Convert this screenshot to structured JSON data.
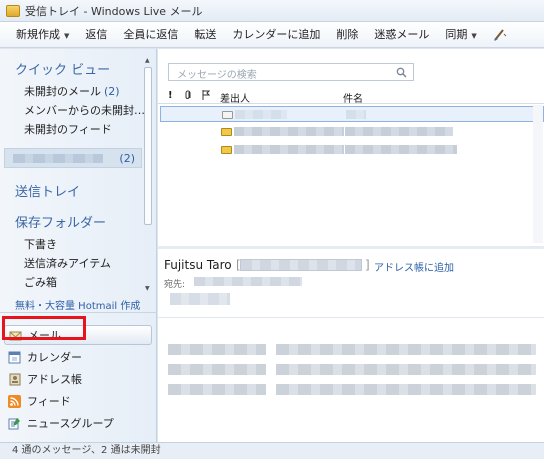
{
  "window": {
    "title": "受信トレイ - Windows Live メール"
  },
  "toolbar": {
    "items": [
      {
        "label": "新規作成",
        "dropdown": true
      },
      {
        "label": "返信"
      },
      {
        "label": "全員に返信"
      },
      {
        "label": "転送"
      },
      {
        "label": "カレンダーに追加"
      },
      {
        "label": "削除"
      },
      {
        "label": "迷惑メール"
      },
      {
        "label": "同期",
        "dropdown": true
      }
    ],
    "customize_icon": "paintbrush-icon"
  },
  "sidebar": {
    "quick_views": {
      "heading": "クイック ビュー",
      "items": [
        {
          "label": "未開封のメール",
          "count": "(2)"
        },
        {
          "label": "メンバーからの未開封…",
          "count": ""
        },
        {
          "label": "未開封のフィード",
          "count": ""
        }
      ]
    },
    "account": {
      "count": "(2)"
    },
    "outbox": "送信トレイ",
    "storage": {
      "heading": "保存フォルダー",
      "items": [
        {
          "label": "下書き"
        },
        {
          "label": "送信済みアイテム"
        },
        {
          "label": "ごみ箱"
        }
      ]
    },
    "hotmail_link": "無料・大容量 Hotmail 作成",
    "nav": [
      {
        "label": "メール",
        "icon": "mail-icon",
        "selected": true
      },
      {
        "label": "カレンダー",
        "icon": "calendar-icon",
        "selected": false
      },
      {
        "label": "アドレス帳",
        "icon": "address-book-icon",
        "selected": false,
        "highlighted": true
      },
      {
        "label": "フィード",
        "icon": "rss-feed-icon",
        "selected": false
      },
      {
        "label": "ニュースグループ",
        "icon": "newsgroup-icon",
        "selected": false
      }
    ]
  },
  "message_list": {
    "search_placeholder": "メッセージの検索",
    "columns": {
      "importance": "!",
      "attachment": "",
      "flag": "",
      "sender": "差出人",
      "subject": "件名"
    },
    "rows": [
      {
        "state": "read",
        "selected": true
      },
      {
        "state": "unread",
        "selected": false
      },
      {
        "state": "unread",
        "selected": false
      }
    ]
  },
  "reading_pane": {
    "sender": "Fujitsu Taro",
    "add_link": "アドレス帳に追加",
    "to_label": "宛先:"
  },
  "status_bar": {
    "text": "4 通のメッセージ、2 通は未開封"
  },
  "colors": {
    "accent": "#2d5fa8",
    "heading": "#3a67a6",
    "highlight": "#e8141b"
  }
}
